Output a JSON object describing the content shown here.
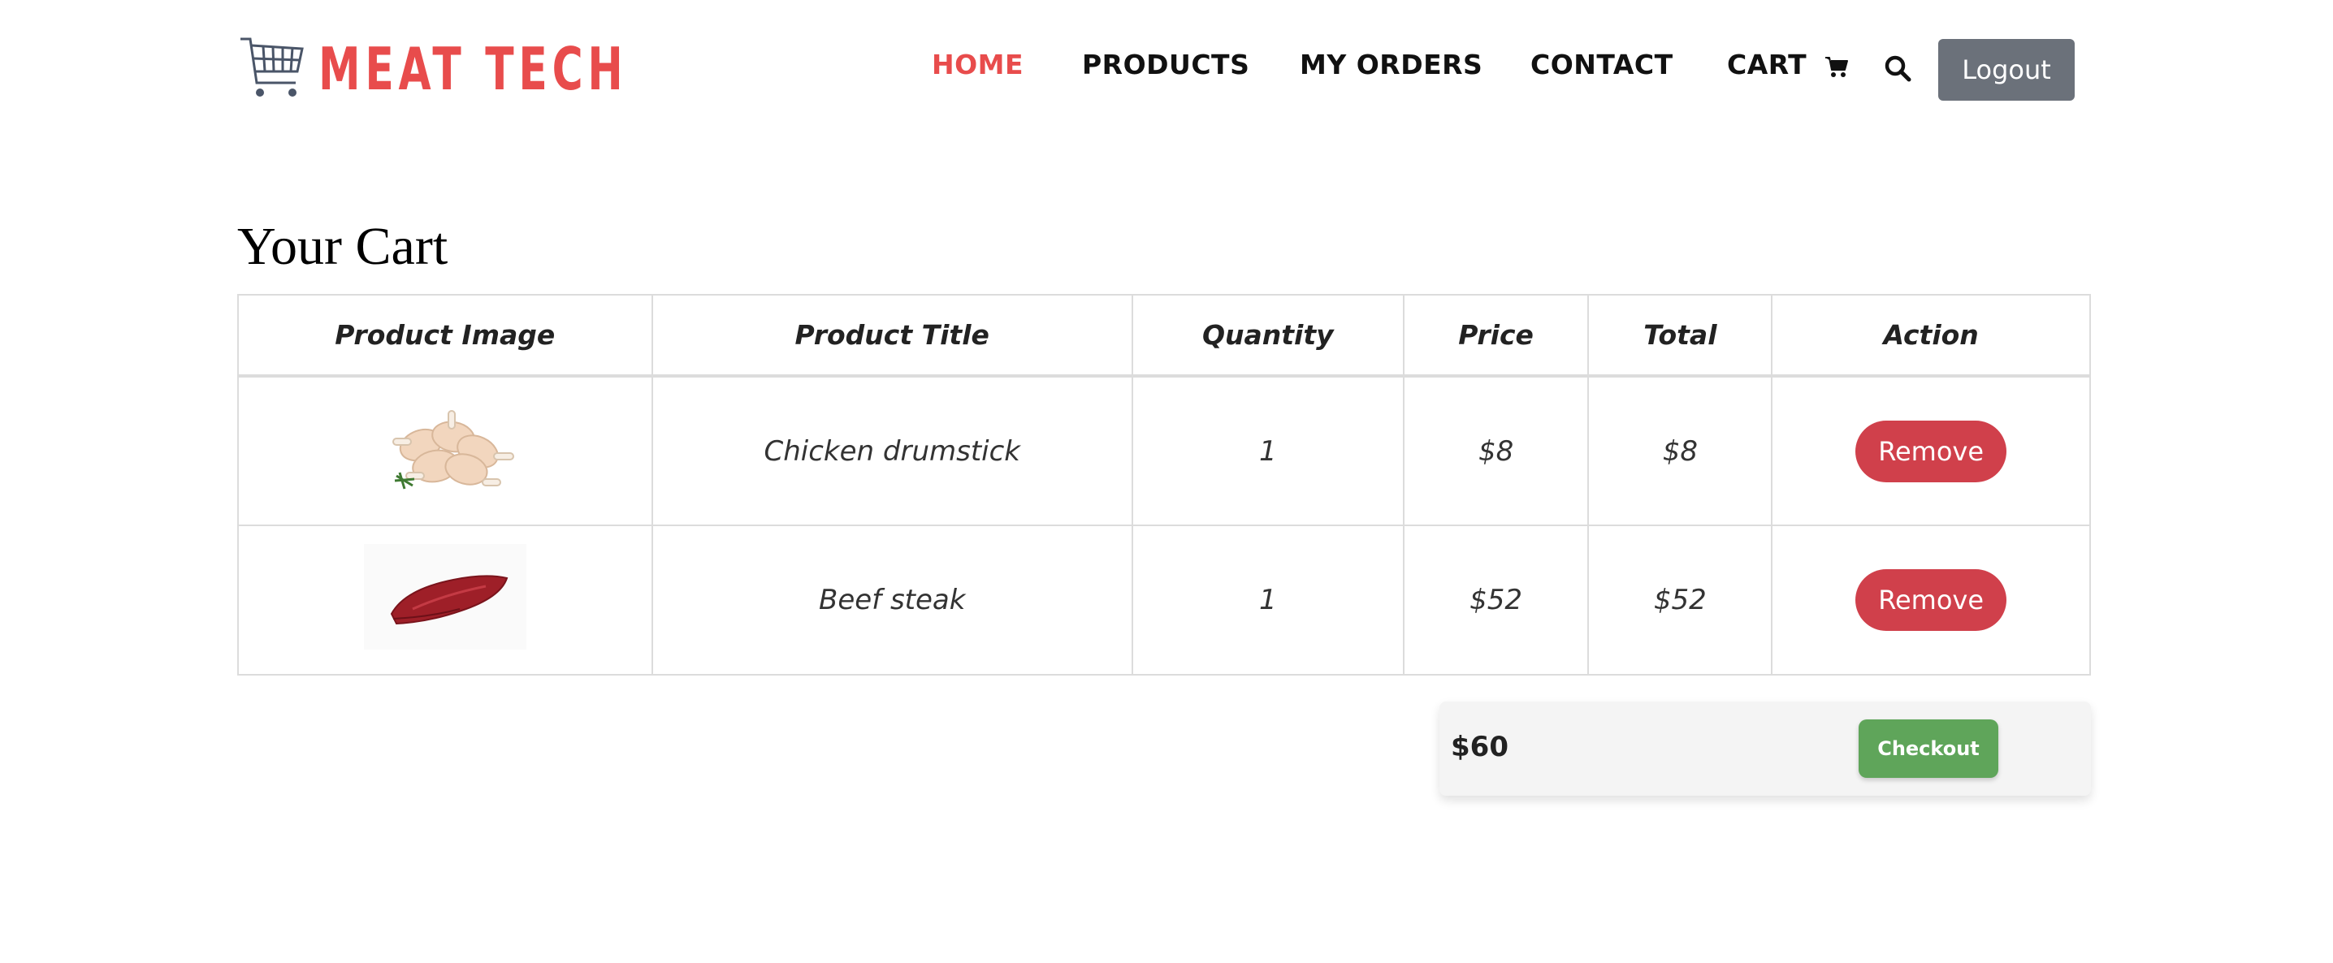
{
  "brand": {
    "name": "MEAT TECH",
    "color": "#e84c4c",
    "logo_icon": "shopping-cart-icon"
  },
  "nav": {
    "items": [
      {
        "label": "HOME",
        "active": true
      },
      {
        "label": "PRODUCTS",
        "active": false
      },
      {
        "label": "MY ORDERS",
        "active": false
      },
      {
        "label": "CONTACT",
        "active": false
      },
      {
        "label": "CART",
        "active": false,
        "icon": "cart-icon"
      }
    ],
    "search_icon": "search-icon",
    "logout_label": "Logout"
  },
  "page": {
    "title": "Your Cart"
  },
  "table": {
    "headers": [
      "Product Image",
      "Product Title",
      "Quantity",
      "Price",
      "Total",
      "Action"
    ],
    "rows": [
      {
        "image": "chicken-drumstick-image",
        "title": "Chicken drumstick",
        "quantity": "1",
        "price": "$8",
        "total": "$8",
        "action": "Remove"
      },
      {
        "image": "beef-steak-image",
        "title": "Beef steak",
        "quantity": "1",
        "price": "$52",
        "total": "$52",
        "action": "Remove"
      }
    ]
  },
  "summary": {
    "grand_total": "$60",
    "checkout_label": "Checkout"
  },
  "colors": {
    "accent": "#e84c4c",
    "remove": "#d0404b",
    "checkout": "#5fa55a",
    "logout": "#6b717a"
  }
}
